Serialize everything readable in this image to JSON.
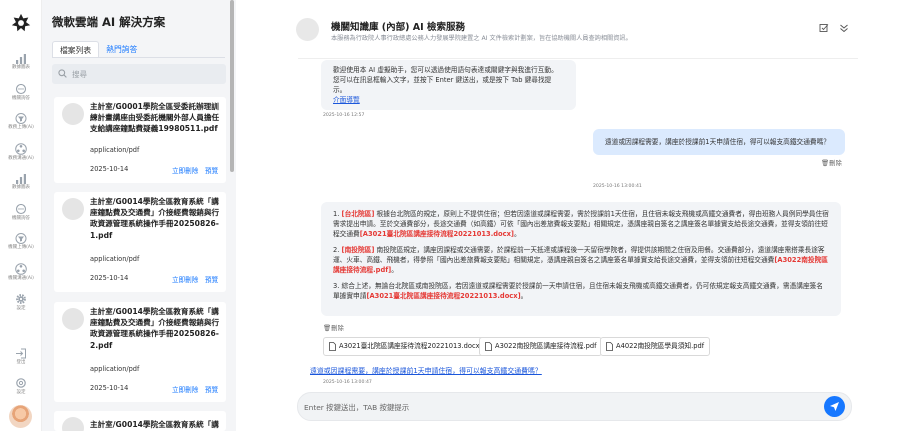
{
  "rail": {
    "items": [
      {
        "label": "數據圖表"
      },
      {
        "label": "機關詢答"
      },
      {
        "label": "教務上傳(Ai)"
      },
      {
        "label": "教務溝通(Ai)"
      },
      {
        "label": "數據圖表"
      },
      {
        "label": "機關詢答"
      },
      {
        "label": "機關上傳(Ai)"
      },
      {
        "label": "機關溝通(Ai)"
      },
      {
        "label": "設定"
      },
      {
        "label": "登出"
      },
      {
        "label": "設定"
      }
    ]
  },
  "docs": {
    "title": "微軟雲端 AI 解決方案",
    "tabs": [
      {
        "label": "檔案列表"
      },
      {
        "label": "熱門詢答"
      }
    ],
    "search_placeholder": "搜尋",
    "items": [
      {
        "title": "主計室/G0001學院全區受委託辦理訓練計畫講座由受委託機關外部人員擔任支給講座鐘點費疑義19980511.pdf",
        "type": "application/pdf",
        "date": "2025-10-14",
        "delete": "立即刪除",
        "preview": "預覽"
      },
      {
        "title": "主計室/G0014學院全區教育系統「講座鐘點費及交通費」介接經費報銷與行政資源管理系統操作手冊20250826-1.pdf",
        "type": "application/pdf",
        "date": "2025-10-14",
        "delete": "立即刪除",
        "preview": "預覽"
      },
      {
        "title": "主計室/G0014學院全區教育系統「講座鐘點費及交通費」介接經費報銷與行政資源管理系統操作手冊20250826-2.pdf",
        "type": "application/pdf",
        "date": "2025-10-14",
        "delete": "立即刪除",
        "preview": "預覽"
      },
      {
        "title": "主計室/G0014學院全區教育系統「講"
      }
    ]
  },
  "chat": {
    "title": "機關知識庫 (內部) AI 檢索服務",
    "subtitle": "本服務為行政院人事行政總處公務人力發展學院建置之 AI 文件檢索計劃案，旨在協助機關人員查詢相關資訊。",
    "welcome": {
      "line1": "歡迎使用本 AI 虛擬助手，您可以透過使用語句表達或關鍵字與我進行互動。",
      "line2": "您可以在訊息框輸入文字，並按下 Enter 鍵送出，或是按下 Tab 鍵尋找提示。",
      "link": "介面導覽",
      "time": "2025-10-16 12:57"
    },
    "user_message": {
      "text": "遠道或因課程需要，講座於授課前1天申請住宿，得可以報支高鐵交通費嗎？",
      "delete": "刪除",
      "time": "2025-10-16 13:00:41"
    },
    "answer": {
      "p1_prefix": "1. ",
      "p1_tag": "[台北院區]",
      "p1_text": " 根據台北院區的規定，原則上不提供住宿；但若因遠道或課程需要，需於授課前1天住宿，且住宿未報支飛機或高鐵交通費者，得由班務人員例同學員住宿需求提出申請。至於交通費部分，長途交通費（如高鐵）可依「國內出差旅費報支要點」相關規定，憑講座親自簽名之講座簽名單據實支給長途交通費，並得支領前往短程交通費",
      "p1_ref": "[A3021臺北院區講座接待流程20221013.docx]",
      "p1_end": "。",
      "p2_prefix": "2. ",
      "p2_tag": "[南投院區]",
      "p2_text": " 南投院區規定，講座因課程或交通需要，於課程前一天抵達或課程後一天留宿學院者，得提供該期間之住宿及用餐。交通費部分，遠道講座需搭乘長途客運、火車、高鐵、飛機者，得參照「國內出差旅費報支要點」相關規定，憑講座親自簽名之講座簽名單據實支給長途交通費，並得支領前往短程交通費",
      "p2_ref": "[A3022南投院區講座接待流程.pdf]",
      "p2_end": "。",
      "p3_prefix": "3. 綜合上述，無論台北院區或南投院區，若因遠道或課程需要於授課前一天申請住宿，且住宿未報支飛機或高鐵交通費者，仍可依規定報支高鐵交通費，需憑講座簽名單據實申請",
      "p3_ref": "[A3021臺北院區講座接待流程20221013.docx]",
      "p3_end": "。",
      "delete": "刪除",
      "attachments": [
        {
          "name": "A3021臺北院區講座接待流程20221013.docx"
        },
        {
          "name": "A3022南投院區講座接待流程.pdf"
        },
        {
          "name": "A4022南投院區學員須知.pdf"
        }
      ],
      "suggestion": "遠道或因課程需要，講座於授課前1天申請住宿，得可以報支高鐵交通費嗎？",
      "time": "2025-10-16 13:00:47"
    },
    "input_placeholder": "Enter 按鍵送出，TAB 按鍵提示"
  },
  "colors": {
    "accent": "#1677ff",
    "reference_red": "#e53935",
    "user_bubble": "#dbeafe"
  }
}
